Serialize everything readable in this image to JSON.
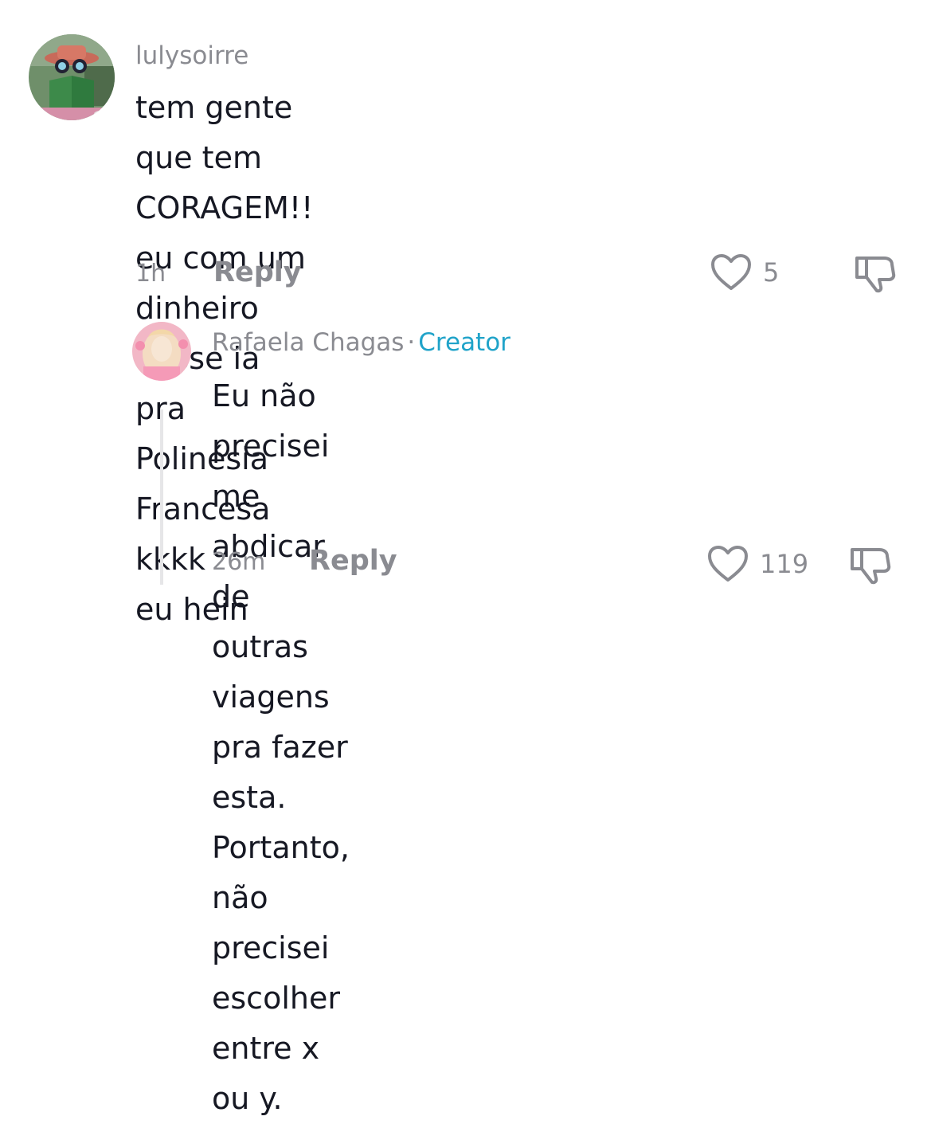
{
  "comment": {
    "username": "lulysoirre",
    "text_lines": [
      "tem gente que tem CORAGEM!! eu com um",
      "dinheiro desse ia pra Polinésia Francesa kkkk",
      "eu hein"
    ],
    "time": "1h",
    "reply_label": "Reply",
    "likes": "5",
    "icons": {
      "like": "heart-icon",
      "dislike": "thumbs-down-icon"
    }
  },
  "reply": {
    "username": "Rafaela Chagas",
    "separator": "·",
    "badge": "Creator",
    "text_lines": [
      "Eu não precisei me abdicar de outras",
      "viagens pra fazer esta. Portanto, não",
      "precisei escolher entre x ou y."
    ],
    "time": "26m",
    "reply_label": "Reply",
    "likes": "119",
    "icons": {
      "like": "heart-icon",
      "dislike": "thumbs-down-icon"
    }
  },
  "colors": {
    "text": "#161823",
    "muted": "#8a8b91",
    "creator": "#20a3c9"
  }
}
